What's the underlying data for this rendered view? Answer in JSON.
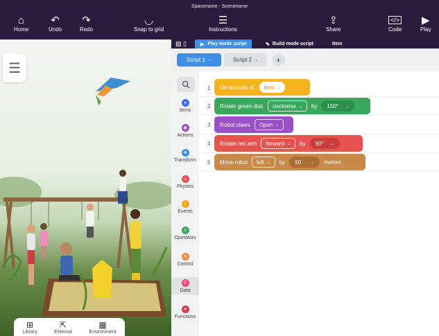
{
  "window_title": "Spacename - Scenename",
  "toolbar": {
    "home": "Home",
    "undo": "Undo",
    "redo": "Redo",
    "snap": "Snap to grid",
    "instructions": "Instructions",
    "share": "Share",
    "code": "Code",
    "play": "Play"
  },
  "mode_tabs": {
    "play_mode": "Play mode script",
    "build_mode": "Build mode script",
    "item": "Item"
  },
  "script_tabs": [
    {
      "label": "Script 1"
    },
    {
      "label": "Script 2"
    }
  ],
  "add_script": "+",
  "categories": [
    {
      "label": "Items",
      "color": "#3d6ee8"
    },
    {
      "label": "Actions",
      "color": "#9b4fc9"
    },
    {
      "label": "Transform",
      "color": "#3d8fe8"
    },
    {
      "label": "Physics",
      "color": "#e8534f"
    },
    {
      "label": "Events",
      "color": "#f5a623"
    },
    {
      "label": "Operators",
      "color": "#3aa85c"
    },
    {
      "label": "Control",
      "color": "#f58a3a"
    },
    {
      "label": "Data",
      "color": "#e8476a"
    },
    {
      "label": "Functions",
      "color": "#d93a4a"
    }
  ],
  "script_lines": [
    {
      "num": "1",
      "text": "On activate of",
      "pill": "Item",
      "color": "#f6b21f"
    },
    {
      "num": "2",
      "text": "Rotate green disk",
      "pill": "clockwise",
      "word": "by",
      "value": "150°",
      "color": "#3aa85c",
      "pill_bg": "#2d8f4c"
    },
    {
      "num": "3",
      "text": "Robot claws",
      "pill": "Open",
      "color": "#9b4fc9"
    },
    {
      "num": "4",
      "text": "Rotate red arm",
      "pill": "forward",
      "word": "by",
      "value": "90°",
      "color": "#e5534f",
      "pill_bg": "#c93d3a"
    },
    {
      "num": "5",
      "text": "Move robot",
      "pill": "left",
      "word": "by",
      "value": "50",
      "word2": "meters",
      "color": "#c88a4a",
      "pill_bg": "#a86e36"
    }
  ],
  "bottom_panel": {
    "library": "Library",
    "external": "External",
    "environment": "Environment"
  }
}
